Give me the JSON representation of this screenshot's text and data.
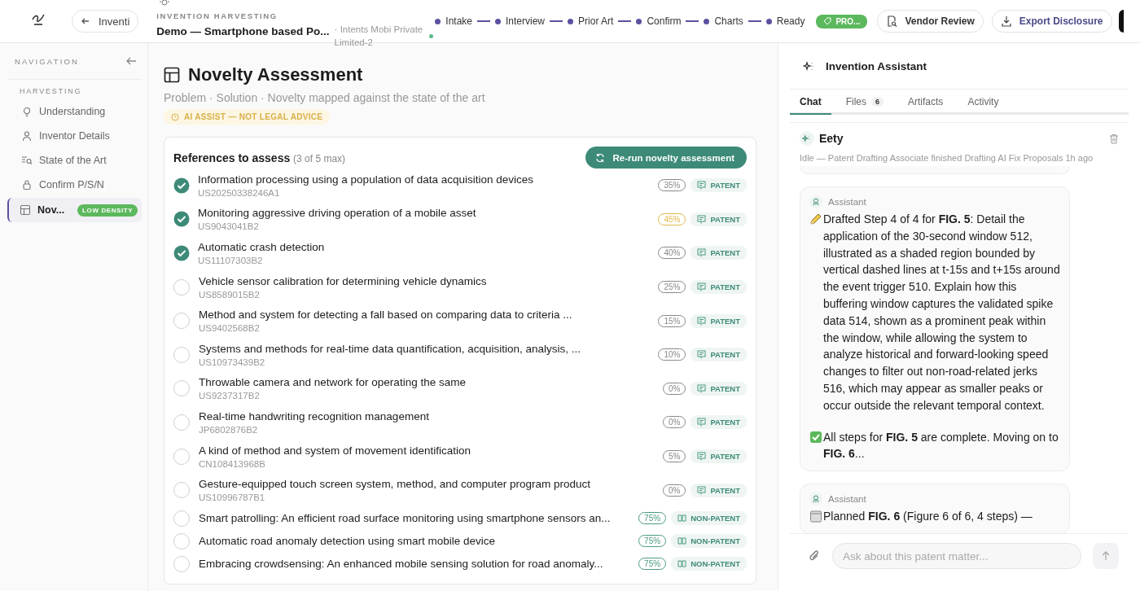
{
  "topbar": {
    "back_button": "Inventi",
    "breadcrumb": "INVENTION HARVESTING",
    "title": "Demo — Smartphone based Po...",
    "company": "· Intents Mobi Private Limited-2",
    "steps": [
      {
        "label": "Intake"
      },
      {
        "label": "Interview"
      },
      {
        "label": "Prior Art"
      },
      {
        "label": "Confirm"
      },
      {
        "label": "Charts"
      },
      {
        "label": "Ready"
      }
    ],
    "status_badge": "PRO...",
    "buttons": [
      {
        "label": "Vendor Review",
        "kind": "review"
      },
      {
        "label": "Export Disclosure",
        "kind": "export"
      }
    ]
  },
  "sidebar": {
    "heading": "NAVIGATION",
    "section": "HARVESTING",
    "items": [
      {
        "label": "Understanding",
        "kind": "bulb",
        "selected": false
      },
      {
        "label": "Inventor Details",
        "kind": "person",
        "selected": false
      },
      {
        "label": "State of the Art",
        "kind": "search",
        "selected": false
      },
      {
        "label": "Confirm P/S/N",
        "kind": "lock",
        "selected": false
      },
      {
        "label": "Nov...",
        "kind": "table",
        "selected": true,
        "badge": "LOW DENSITY"
      }
    ]
  },
  "main": {
    "title": "Novelty Assessment",
    "subtitle": "Problem · Solution · Novelty mapped against the state of the art",
    "notice": "AI ASSIST — NOT LEGAL ADVICE",
    "card_title": "References to assess",
    "card_count": "(3 of 5 max)",
    "rerun_button": "Re-run novelty assessment",
    "references": [
      {
        "title": "Information processing using a population of data acquisition devices",
        "id": "US20250338246A1",
        "checked": true,
        "score": "35%",
        "color": "#888888",
        "type": "PATENT",
        "kind": "patent"
      },
      {
        "title": "Monitoring aggressive driving operation of a mobile asset",
        "id": "US9043041B2",
        "checked": true,
        "score": "45%",
        "color": "#e0b84a",
        "type": "PATENT",
        "kind": "patent"
      },
      {
        "title": "Automatic crash detection",
        "id": "US11107303B2",
        "checked": true,
        "score": "40%",
        "color": "#888888",
        "type": "PATENT",
        "kind": "patent"
      },
      {
        "title": "Vehicle sensor calibration for determining vehicle dynamics",
        "id": "US8589015B2",
        "checked": false,
        "score": "25%",
        "color": "#888888",
        "type": "PATENT",
        "kind": "patent"
      },
      {
        "title": "Method and system for detecting a fall based on comparing data to criteria ...",
        "id": "US9402568B2",
        "checked": false,
        "score": "15%",
        "color": "#888888",
        "type": "PATENT",
        "kind": "patent"
      },
      {
        "title": "Systems and methods for real-time data quantification, acquisition, analysis, ...",
        "id": "US10973439B2",
        "checked": false,
        "score": "10%",
        "color": "#888888",
        "type": "PATENT",
        "kind": "patent"
      },
      {
        "title": "Throwable camera and network for operating the same",
        "id": "US9237317B2",
        "checked": false,
        "score": "0%",
        "color": "#888888",
        "type": "PATENT",
        "kind": "patent"
      },
      {
        "title": "Real-time handwriting recognition management",
        "id": "JP6802876B2",
        "checked": false,
        "score": "0%",
        "color": "#888888",
        "type": "PATENT",
        "kind": "patent"
      },
      {
        "title": "A kind of method and system of movement identification",
        "id": "CN108413968B",
        "checked": false,
        "score": "5%",
        "color": "#888888",
        "type": "PATENT",
        "kind": "patent"
      },
      {
        "title": "Gesture-equipped touch screen system, method, and computer program product",
        "id": "US10996787B1",
        "checked": false,
        "score": "0%",
        "color": "#888888",
        "type": "PATENT",
        "kind": "patent"
      },
      {
        "title": "Smart patrolling: An efficient road surface monitoring using smartphone sensors an...",
        "checked": false,
        "score": "75%",
        "color": "#4a9a82",
        "type": "NON-PATENT",
        "kind": "nonpatent"
      },
      {
        "title": "Automatic road anomaly detection using smart mobile device",
        "checked": false,
        "score": "75%",
        "color": "#4a9a82",
        "type": "NON-PATENT",
        "kind": "nonpatent"
      },
      {
        "title": "Embracing crowdsensing: An enhanced mobile sensing solution for road anomaly...",
        "checked": false,
        "score": "75%",
        "color": "#4a9a82",
        "type": "NON-PATENT",
        "kind": "nonpatent"
      }
    ]
  },
  "assistant": {
    "title": "Invention Assistant",
    "tabs": [
      {
        "label": "Chat",
        "selected": true
      },
      {
        "label": "Files",
        "count": "6",
        "selected": false
      },
      {
        "label": "Artifacts",
        "selected": false
      },
      {
        "label": "Activity",
        "selected": false
      }
    ],
    "agent": {
      "name": "Eety",
      "status": "Idle — Patent Drafting Associate finished Drafting AI Fix Proposals 1h ago"
    },
    "messages": [
      {
        "author": "Assistant",
        "paragraphs": [
          {
            "kind": "pencil",
            "text": "Drafted Step 4 of 4 for **FIG. 5**: Detail the application of the 30-second window 512, illustrated as a shaded region bounded by vertical dashed lines at t-15s and t+15s around the event trigger 510. Explain how this buffering window captures the validated spike data 514, shown as a prominent peak within the window, while allowing the system to analyze historical and forward-looking speed changes to filter out non-road-related jerks 516, which may appear as smaller peaks or occur outside the relevant temporal context."
          },
          {
            "kind": "check",
            "text": "All steps for **FIG. 5** are complete. Moving on to **FIG. 6**..."
          }
        ]
      },
      {
        "author": "Assistant",
        "paragraphs": [
          {
            "kind": "calendar",
            "text": "Planned **FIG. 6** (Figure 6 of 6, 4 steps) —"
          }
        ]
      }
    ],
    "input": {
      "placeholder": "Ask about this patent matter..."
    }
  }
}
